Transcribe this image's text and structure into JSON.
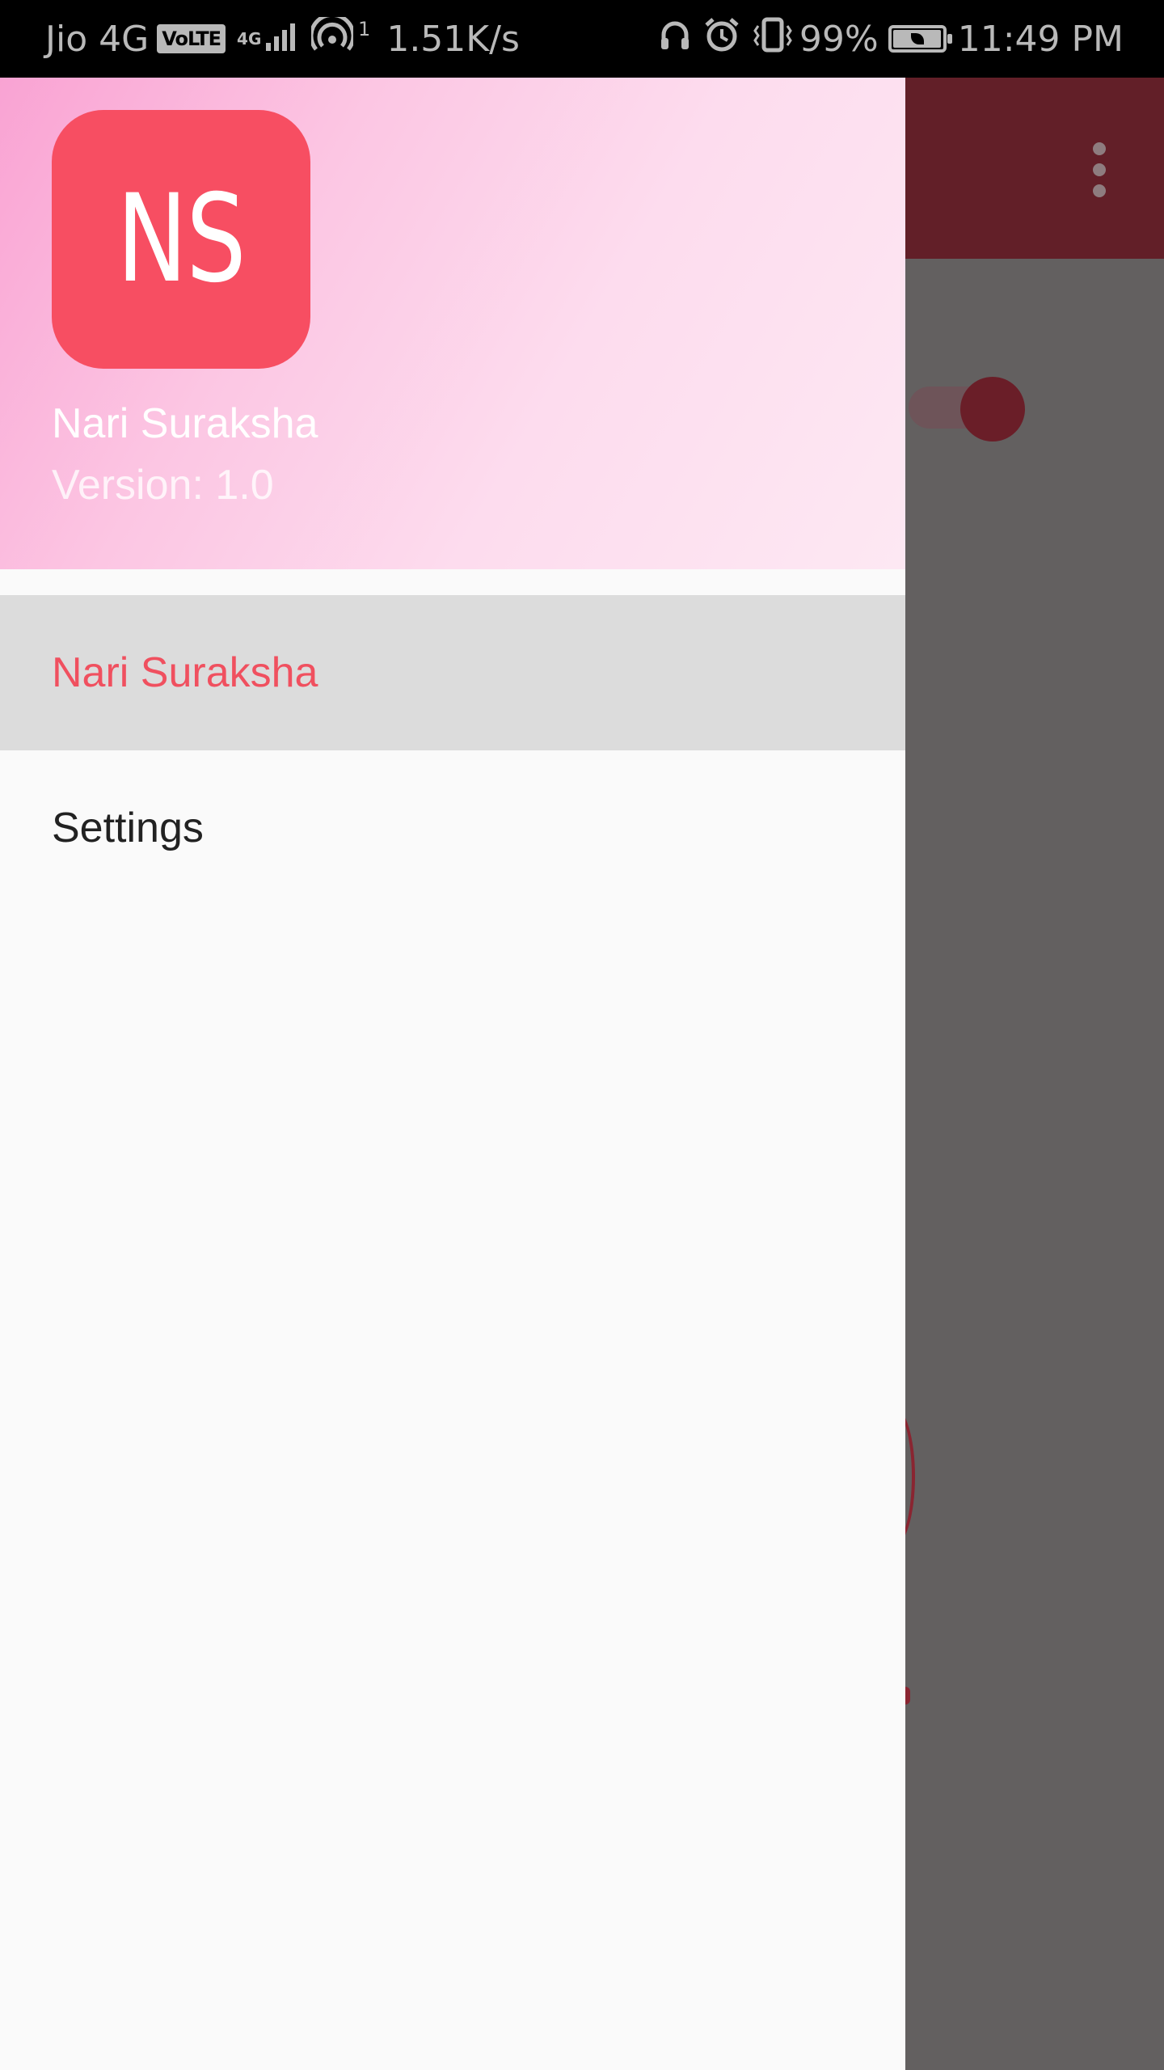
{
  "status_bar": {
    "carrier": "Jio 4G",
    "volte_badge": "VoLTE",
    "network_type": "4G",
    "hotspot_clients": "1",
    "network_speed": "1.51K/s",
    "battery_percent": "99%",
    "battery_level": 0.99,
    "time": "11:49 PM",
    "icons": [
      "headset-icon",
      "alarm-icon",
      "vibrate-icon",
      "battery-saver-icon"
    ]
  },
  "drawer": {
    "header": {
      "logo_text": "NS",
      "app_name": "Nari Suraksha",
      "version": "Version: 1.0"
    },
    "menu": {
      "items": [
        {
          "label": "Nari Suraksha",
          "selected": true
        },
        {
          "label": "Settings",
          "selected": false
        }
      ]
    }
  },
  "background_app": {
    "toggle_checked": true
  },
  "colors": {
    "accent": "#f0505f",
    "logo_background": "#f74e62",
    "selected_item_background": "#dcdcdc",
    "scrim_background": "#636060",
    "app_bar_dimmed": "#621f28",
    "header_gradient_start": "#f9a3d3",
    "header_gradient_end": "#fde8f3"
  }
}
